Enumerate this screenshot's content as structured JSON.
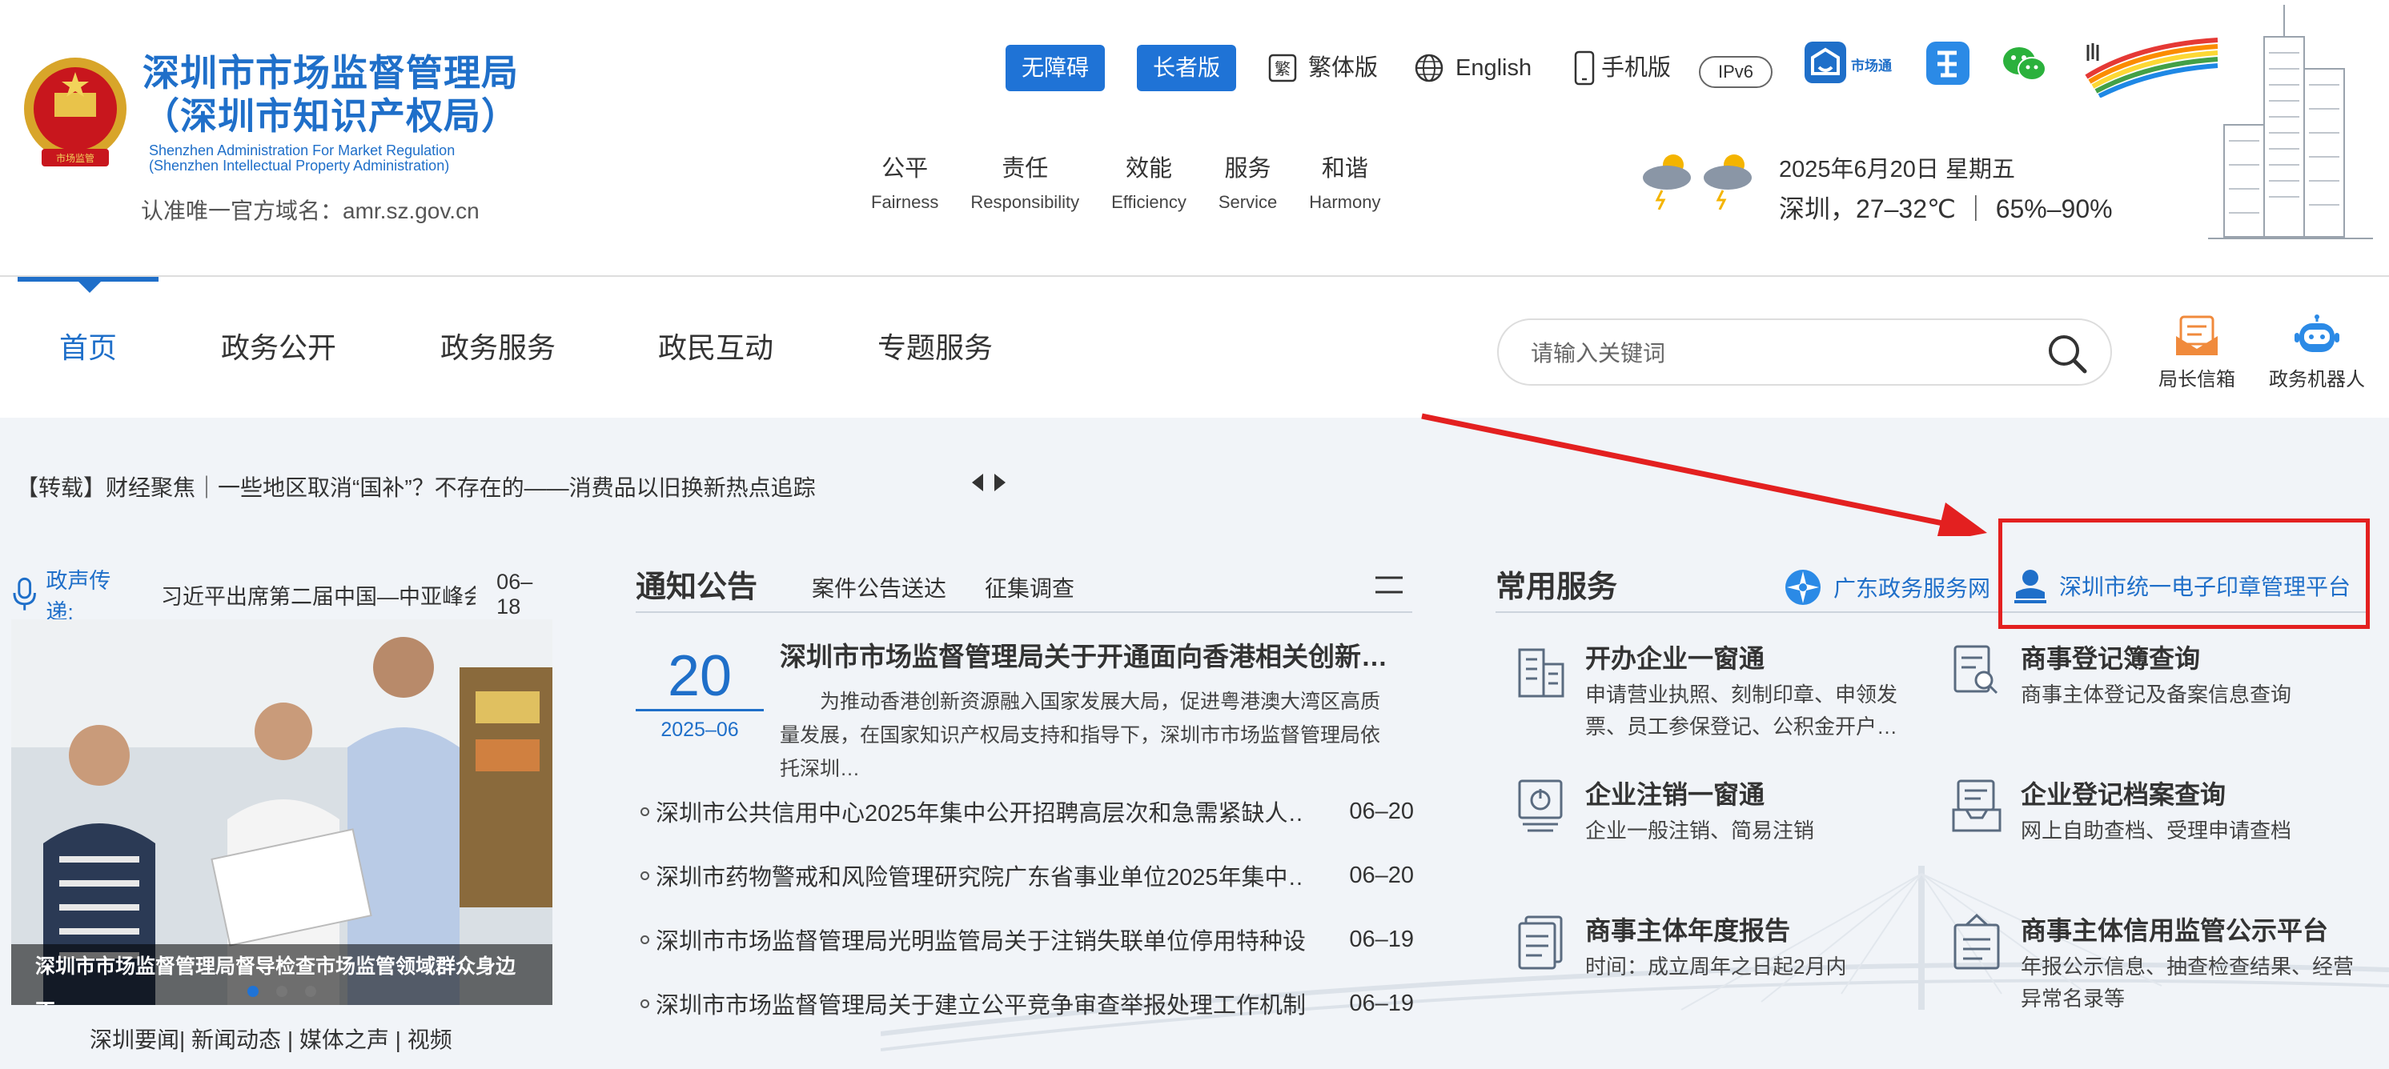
{
  "header": {
    "title_line1": "深圳市市场监督管理局",
    "title_line2": "（深圳市知识产权局）",
    "title_en_line1": "Shenzhen Administration For Market Regulation",
    "title_en_line2": "(Shenzhen Intellectual Property Administration)",
    "domain_note": "认准唯一官方域名：amr.sz.gov.cn",
    "accessibility_button": "无障碍",
    "elderly_button": "长者版",
    "traditional_label": "繁体版",
    "english_label": "English",
    "mobile_label": "手机版",
    "ipv6_label": "IPv6",
    "app_label": "市场通",
    "values": [
      {
        "cn": "公平",
        "en": "Fairness"
      },
      {
        "cn": "责任",
        "en": "Responsibility"
      },
      {
        "cn": "效能",
        "en": "Efficiency"
      },
      {
        "cn": "服务",
        "en": "Service"
      },
      {
        "cn": "和谐",
        "en": "Harmony"
      }
    ],
    "weather_date": "2025年6月20日 星期五",
    "weather_info": "深圳，27–32℃ ｜ 65%–90%"
  },
  "nav": {
    "items": [
      "首页",
      "政务公开",
      "政务服务",
      "政民互动",
      "专题服务"
    ],
    "search_placeholder": "请输入关键词",
    "mailbox_label": "局长信箱",
    "robot_label": "政务机器人"
  },
  "ticker": {
    "text": "【转载】财经聚焦｜一些地区取消“国补”？不存在的——消费品以旧换新热点追踪"
  },
  "news": {
    "voice_label": "政声传递:",
    "voice_text": "习近平出席第二届中国—中亚峰会…",
    "voice_date": "06–18",
    "photo_caption": "深圳市市场监督管理局督导检查市场监管领域群众身边不…",
    "links": "深圳要闻| 新闻动态 | 媒体之声 | 视频"
  },
  "notice": {
    "title": "通知公告",
    "tab1": "案件公告送达",
    "tab2": "征集调查",
    "featured_day": "20",
    "featured_ym": "2025–06",
    "featured_title": "深圳市市场监督管理局关于开通面向香港相关创新主体的…",
    "featured_body": "为推动香港创新资源融入国家发展大局，促进粤港澳大湾区高质量发展，在国家知识产权局支持和指导下，深圳市市场监督管理局依托深圳…",
    "items": [
      {
        "text": "深圳市公共信用中心2025年集中公开招聘高层次和急需紧缺人…",
        "date": "06–20"
      },
      {
        "text": "深圳市药物警戒和风险管理研究院广东省事业单位2025年集中…",
        "date": "06–20"
      },
      {
        "text": "深圳市市场监督管理局光明监管局关于注销失联单位停用特种设…",
        "date": "06–19"
      },
      {
        "text": "深圳市市场监督管理局关于建立公平竞争审查举报处理工作机制…",
        "date": "06–19"
      }
    ]
  },
  "services": {
    "title": "常用服务",
    "gd_link": "广东政务服务网",
    "seal_link": "深圳市统一电子印章管理平台",
    "items": [
      {
        "name": "开办企业一窗通",
        "desc": "申请营业执照、刻制印章、申领发票、员工参保登记、公积金开户…",
        "icon": "building-icon"
      },
      {
        "name": "商事登记簿查询",
        "desc": "商事主体登记及备案信息查询",
        "icon": "document-search-icon"
      },
      {
        "name": "企业注销一窗通",
        "desc": "企业一般注销、简易注销",
        "icon": "power-monitor-icon"
      },
      {
        "name": "企业登记档案查询",
        "desc": "网上自助查档、受理申请查档",
        "icon": "archive-icon"
      },
      {
        "name": "商事主体年度报告",
        "desc": "时间：成立周年之日起2月内",
        "icon": "report-icon"
      },
      {
        "name": "商事主体信用监管公示平台",
        "desc": "年报公示信息、抽查检查结果、经营异常名录等",
        "icon": "bulletin-icon"
      }
    ]
  },
  "colors": {
    "brand_blue": "#1f6fc9",
    "button_blue": "#1f73d6",
    "highlight_red": "#e32020",
    "main_bg": "#f1f4f8"
  }
}
